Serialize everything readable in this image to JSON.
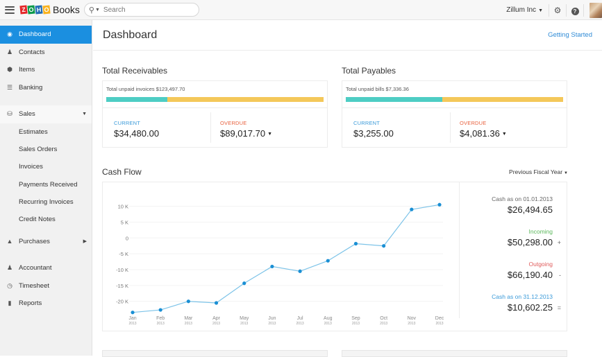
{
  "topbar": {
    "brand_letters": [
      "Z",
      "O",
      "H",
      "O"
    ],
    "brand_colors": [
      "#e42527",
      "#089949",
      "#226db4",
      "#f9b21d"
    ],
    "app_name": "Books",
    "search_placeholder": "Search",
    "org_name": "Zillum Inc",
    "settings_icon": "gear-icon",
    "help_icon": "help-icon",
    "help_glyph": "?"
  },
  "sidebar": {
    "items": [
      {
        "label": "Dashboard",
        "icon": "dashboard-icon",
        "glyph": "◉",
        "active": true
      },
      {
        "label": "Contacts",
        "icon": "contacts-icon",
        "glyph": "👤"
      },
      {
        "label": "Items",
        "icon": "items-icon",
        "glyph": "⬢"
      },
      {
        "label": "Banking",
        "icon": "bank-icon",
        "glyph": "🏛"
      }
    ],
    "sales": {
      "label": "Sales",
      "glyph": "🛒",
      "arrow": "▼",
      "subitems": [
        "Estimates",
        "Sales Orders",
        "Invoices",
        "Payments Received",
        "Recurring Invoices",
        "Credit Notes"
      ]
    },
    "purchases": {
      "label": "Purchases",
      "glyph": "🛍",
      "arrow": "▶"
    },
    "bottom_items": [
      {
        "label": "Accountant",
        "glyph": "👤"
      },
      {
        "label": "Timesheet",
        "glyph": "⏱"
      },
      {
        "label": "Reports",
        "glyph": "📊"
      }
    ]
  },
  "header": {
    "title": "Dashboard",
    "getting_started": "Getting Started"
  },
  "receivables": {
    "title": "Total Receivables",
    "unpaid_label": "Total unpaid invoices $123,497.70",
    "current_fraction": 0.28,
    "current_label": "CURRENT",
    "current_amount": "$34,480.00",
    "overdue_label": "OVERDUE",
    "overdue_amount": "$89,017.70"
  },
  "payables": {
    "title": "Total Payables",
    "unpaid_label": "Total unpaid bills $7,336.36",
    "current_fraction": 0.444,
    "current_label": "CURRENT",
    "current_amount": "$3,255.00",
    "overdue_label": "OVERDUE",
    "overdue_amount": "$4,081.36"
  },
  "cashflow": {
    "title": "Cash Flow",
    "period": "Previous Fiscal Year",
    "opening_label": "Cash as on 01.01.2013",
    "opening_amount": "$26,494.65",
    "incoming_label": "Incoming",
    "incoming_amount": "$50,298.00",
    "incoming_op": "+",
    "outgoing_label": "Outgoing",
    "outgoing_amount": "$66,190.40",
    "outgoing_op": "-",
    "closing_label": "Cash as on 31.12.2013",
    "closing_amount": "$10,602.25",
    "closing_op": "=",
    "colors": {
      "incoming": "#5cb85c",
      "outgoing": "#e05c5c",
      "closing": "#3a9ad9",
      "line": "#7cc3e8",
      "point": "#1a8fd4"
    }
  },
  "chart_data": {
    "type": "line",
    "title": "Cash Flow",
    "xlabel": "",
    "ylabel": "",
    "categories": [
      "Jan",
      "Feb",
      "Mar",
      "Apr",
      "May",
      "Jun",
      "Jul",
      "Aug",
      "Sep",
      "Oct",
      "Nov",
      "Dec"
    ],
    "category_sublabels": [
      "2013",
      "2013",
      "2013",
      "2013",
      "2013",
      "2013",
      "2013",
      "2013",
      "2013",
      "2013",
      "2013",
      "2013"
    ],
    "series": [
      {
        "name": "Cash Flow",
        "values": [
          -23500,
          -22700,
          -20000,
          -20500,
          -14300,
          -9000,
          -10500,
          -7200,
          -1800,
          -2500,
          9000,
          10500
        ]
      }
    ],
    "yticks": [
      10000,
      5000,
      0,
      -5000,
      -10000,
      -15000,
      -20000
    ],
    "ytick_labels": [
      "10 K",
      "5 K",
      "0",
      "-5 K",
      "-10 K",
      "-15 K",
      "-20 K"
    ],
    "ylim": [
      -24000,
      11000
    ],
    "grid": true,
    "legend": "none"
  }
}
